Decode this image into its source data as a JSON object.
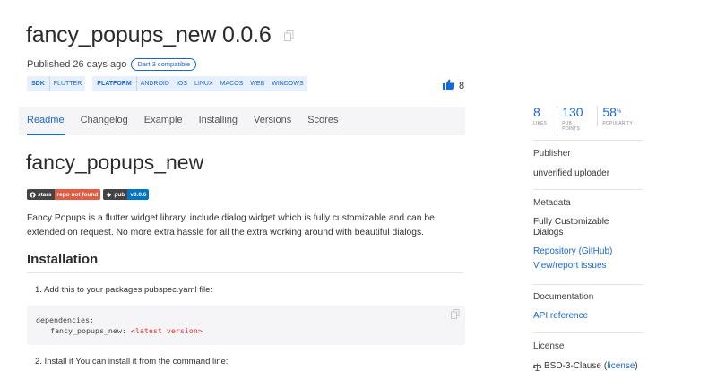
{
  "header": {
    "title": "fancy_popups_new 0.0.6",
    "published": "Published 26 days ago",
    "dart3_badge": "Dart 3 compatible",
    "likes": "8"
  },
  "tags": {
    "sdk": {
      "head": "SDK",
      "items": [
        "FLUTTER"
      ]
    },
    "platform": {
      "head": "PLATFORM",
      "items": [
        "ANDROID",
        "IOS",
        "LINUX",
        "MACOS",
        "WEB",
        "WINDOWS"
      ]
    }
  },
  "tabs": [
    {
      "label": "Readme",
      "active": true
    },
    {
      "label": "Changelog"
    },
    {
      "label": "Example"
    },
    {
      "label": "Installing"
    },
    {
      "label": "Versions"
    },
    {
      "label": "Scores"
    }
  ],
  "readme": {
    "h1": "fancy_popups_new",
    "shields": [
      {
        "left": "stars",
        "right": "repo not found",
        "color": "#e05d44"
      },
      {
        "left": "pub",
        "right": "v0.0.6",
        "color": "#0175c2"
      }
    ],
    "description": "Fancy Popups is a flutter widget library, include dialog widget which is fully customizable and can be extended on request. No more extra hassle for all the extra working around with beautiful dialogs.",
    "installation_heading": "Installation",
    "step1": "1. Add this to your packages pubspec.yaml file:",
    "code_line1": "dependencies:",
    "code_line2_key": "fancy_popups_new: ",
    "code_line2_val": "<latest version>",
    "step2": "2. Install it You can install it from the command line:"
  },
  "sidebar": {
    "scores": [
      {
        "value": "8",
        "label": "LIKES"
      },
      {
        "value": "130",
        "label": "PUB POINTS"
      },
      {
        "value": "58",
        "suffix": "%",
        "label": "POPULARITY"
      }
    ],
    "publisher_head": "Publisher",
    "publisher_val": "unverified uploader",
    "metadata_head": "Metadata",
    "metadata_val": "Fully Customizable Dialogs",
    "repo_link": "Repository (GitHub)",
    "issues_link": "View/report issues",
    "documentation_head": "Documentation",
    "api_link": "API reference",
    "license_head": "License",
    "license_val": "BSD-3-Clause",
    "license_link": "license"
  },
  "colors": {
    "accent": "#1967d2",
    "tag_bg": "#e8f0fe"
  },
  "icons": [
    "copy-icon",
    "thumbs-up-icon",
    "github-icon",
    "pub-icon",
    "license-icon"
  ]
}
